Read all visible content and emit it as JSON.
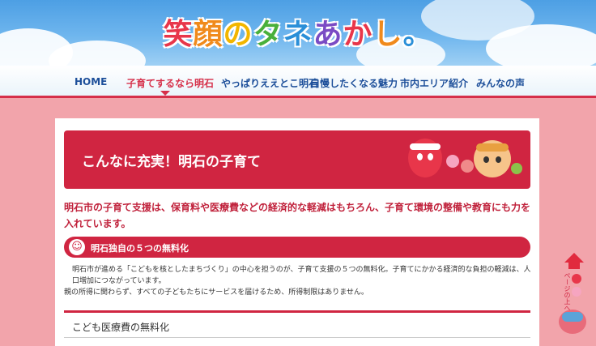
{
  "header": {
    "logo_chars": [
      {
        "text": "笑",
        "color": "#e8364a"
      },
      {
        "text": "顔",
        "color": "#f08a1c"
      },
      {
        "text": "の",
        "color": "#f2b600"
      },
      {
        "text": "タ",
        "color": "#49b03b"
      },
      {
        "text": "ネ",
        "color": "#2a8fd8"
      },
      {
        "text": "あ",
        "color": "#7a4bc4"
      },
      {
        "text": "か",
        "color": "#e8364a"
      },
      {
        "text": "し",
        "color": "#f08a1c"
      },
      {
        "text": "。",
        "color": "#2a8fd8"
      }
    ]
  },
  "nav": {
    "items": [
      {
        "label": "HOME",
        "active": false
      },
      {
        "label": "子育てするなら明石",
        "active": true
      },
      {
        "label": "やっぱりええとこ明石",
        "active": false
      },
      {
        "label": "自慢したくなる魅力",
        "active": false
      },
      {
        "label": "市内エリア紹介",
        "active": false
      },
      {
        "label": "みんなの声",
        "active": false
      }
    ]
  },
  "banner": {
    "title": "こんなに充実！明石の子育て"
  },
  "lead": "明石市の子育て支援は、保育料や医療費などの経済的な軽減はもちろん、子育て環境の整備や教育にも力を入れています。",
  "pill": {
    "icon": "smile-icon",
    "title": "明石独自の５つの無料化"
  },
  "body": {
    "line1": "明石市が進める「こどもを核としたまちづくり」の中心を担うのが、子育て支援の５つの無料化。子育てにかかる経済的な負担の軽減は、人口増加につながっています。",
    "line2": "親の所得に関わらず、すべての子どもたちにサービスを届けるため、所得制限はありません。"
  },
  "section": {
    "title": "こども医療費の無料化"
  },
  "to_top": {
    "label": "ページの上へ",
    "icon": "up-arrow-icon"
  },
  "colors": {
    "accent": "#d02541",
    "nav_text": "#1d4f9a",
    "background": "#f2a4ab"
  }
}
